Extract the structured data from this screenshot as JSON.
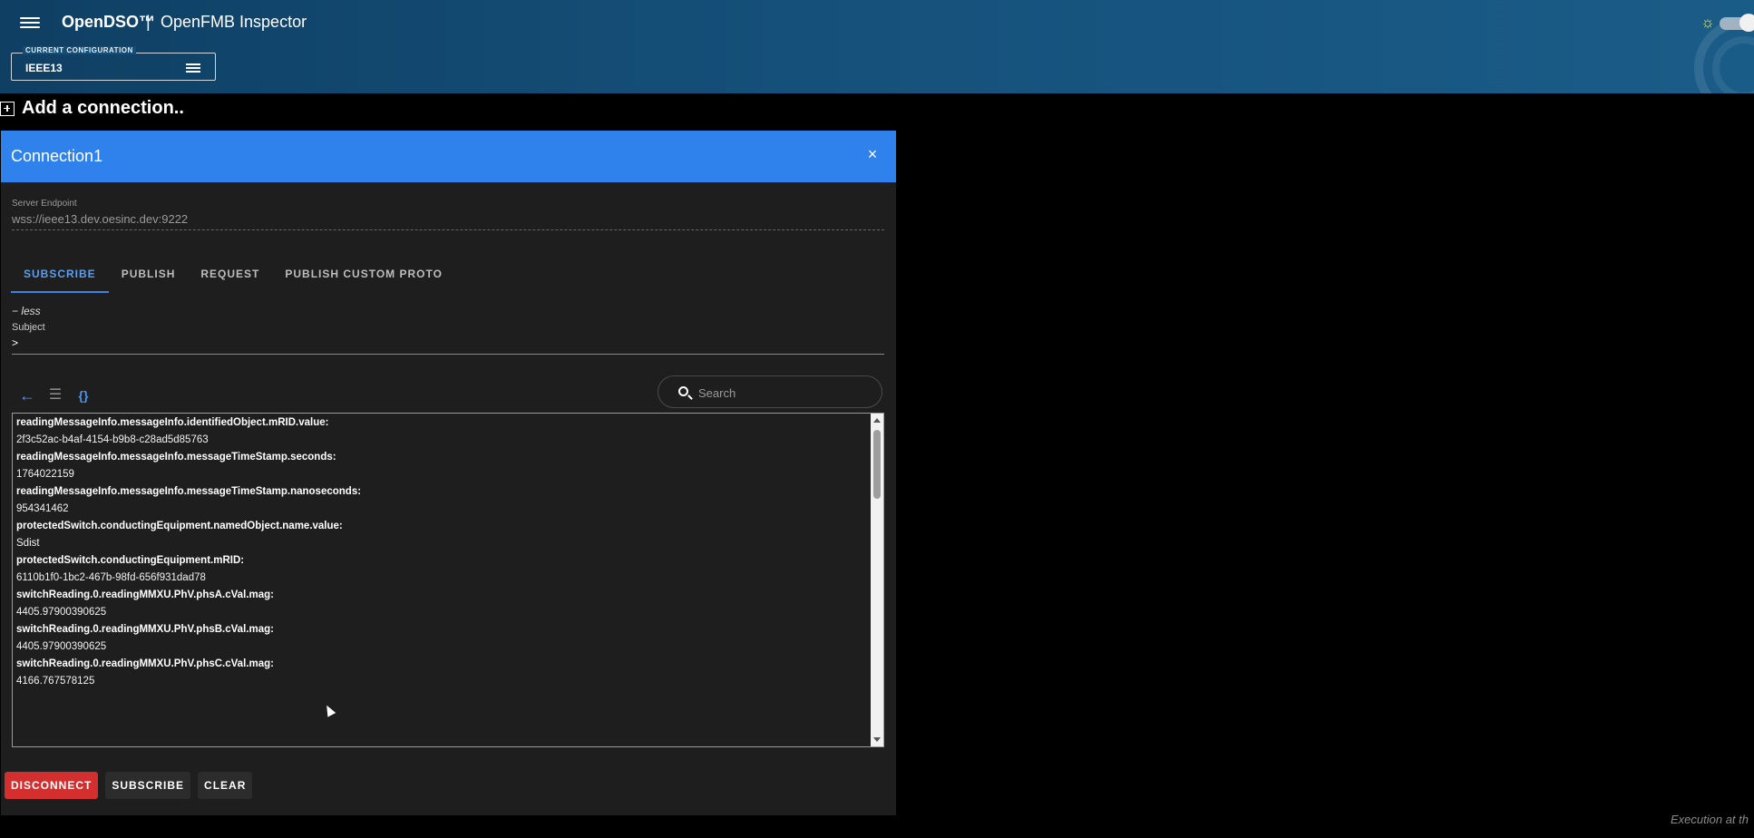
{
  "header": {
    "brand": "OpenDSO™",
    "separator": "|",
    "subtitle": "OpenFMB Inspector",
    "config_legend": "CURRENT CONFIGURATION",
    "config_value": "IEEE13",
    "theme_icon": "sun-icon",
    "accent_color": "#15507a"
  },
  "add_connection": {
    "label": "Add a connection.."
  },
  "panel": {
    "title": "Connection1",
    "close_label": "×",
    "endpoint_label": "Server Endpoint",
    "endpoint_value": "wss://ieee13.dev.oesinc.dev:9222",
    "tabs": [
      {
        "label": "SUBSCRIBE"
      },
      {
        "label": "PUBLISH"
      },
      {
        "label": "REQUEST"
      },
      {
        "label": "PUBLISH CUSTOM PROTO"
      }
    ],
    "less_label": "− less",
    "subject_label": "Subject",
    "subject_value": ">",
    "search_placeholder": "Search",
    "results": [
      {
        "key": "readingMessageInfo.messageInfo.identifiedObject.mRID.value:",
        "value": "2f3c52ac-b4af-4154-b9b8-c28ad5d85763"
      },
      {
        "key": "readingMessageInfo.messageInfo.messageTimeStamp.seconds:",
        "value": "1764022159"
      },
      {
        "key": "readingMessageInfo.messageInfo.messageTimeStamp.nanoseconds:",
        "value": "954341462"
      },
      {
        "key": "protectedSwitch.conductingEquipment.namedObject.name.value:",
        "value": "Sdist"
      },
      {
        "key": "protectedSwitch.conductingEquipment.mRID:",
        "value": "6110b1f0-1bc2-467b-98fd-656f931dad78"
      },
      {
        "key": "switchReading.0.readingMMXU.PhV.phsA.cVal.mag:",
        "value": "4405.97900390625"
      },
      {
        "key": "switchReading.0.readingMMXU.PhV.phsB.cVal.mag:",
        "value": "4405.97900390625"
      },
      {
        "key": "switchReading.0.readingMMXU.PhV.phsC.cVal.mag:",
        "value": "4166.767578125"
      }
    ],
    "actions": {
      "disconnect": "DISCONNECT",
      "subscribe": "SUBSCRIBE",
      "clear": "CLEAR"
    }
  },
  "footer": {
    "text": "Execution at th"
  }
}
